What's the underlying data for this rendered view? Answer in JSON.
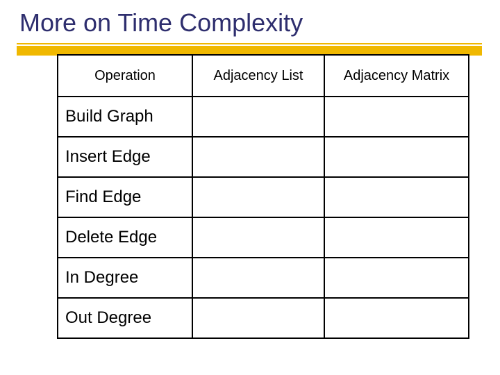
{
  "title": "More on Time Complexity",
  "chart_data": {
    "type": "table",
    "title": "More on Time Complexity",
    "columns": [
      "Operation",
      "Adjacency List",
      "Adjacency Matrix"
    ],
    "rows": [
      {
        "operation": "Build Graph",
        "adjacency_list": "",
        "adjacency_matrix": ""
      },
      {
        "operation": "Insert Edge",
        "adjacency_list": "",
        "adjacency_matrix": ""
      },
      {
        "operation": "Find Edge",
        "adjacency_list": "",
        "adjacency_matrix": ""
      },
      {
        "operation": "Delete Edge",
        "adjacency_list": "",
        "adjacency_matrix": ""
      },
      {
        "operation": "In Degree",
        "adjacency_list": "",
        "adjacency_matrix": ""
      },
      {
        "operation": "Out Degree",
        "adjacency_list": "",
        "adjacency_matrix": ""
      }
    ]
  }
}
